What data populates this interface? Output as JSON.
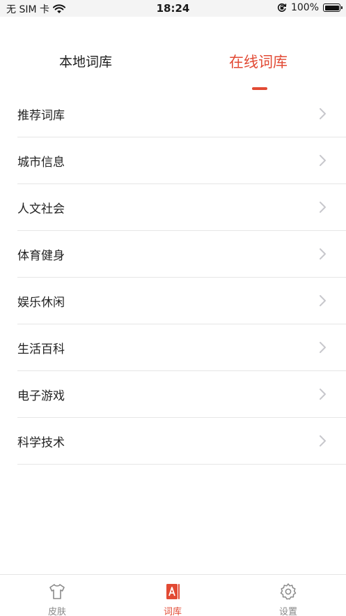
{
  "status_bar": {
    "carrier": "无 SIM 卡",
    "time": "18:24",
    "battery": "100%",
    "icons": [
      "wifi-icon",
      "rotation-lock-icon",
      "battery-icon"
    ]
  },
  "tabs": [
    {
      "label": "本地词库",
      "active": false
    },
    {
      "label": "在线词库",
      "active": true
    }
  ],
  "list": [
    {
      "label": "推荐词库"
    },
    {
      "label": "城市信息"
    },
    {
      "label": "人文社会"
    },
    {
      "label": "体育健身"
    },
    {
      "label": "娱乐休闲"
    },
    {
      "label": "生活百科"
    },
    {
      "label": "电子游戏"
    },
    {
      "label": "科学技术"
    }
  ],
  "bottom_nav": [
    {
      "label": "皮肤",
      "icon": "tshirt-icon",
      "active": false
    },
    {
      "label": "词库",
      "icon": "dictionary-icon",
      "active": true
    },
    {
      "label": "设置",
      "icon": "gear-icon",
      "active": false
    }
  ],
  "colors": {
    "accent": "#e24a34",
    "inactive": "#888888",
    "divider": "#e6e6e6"
  }
}
